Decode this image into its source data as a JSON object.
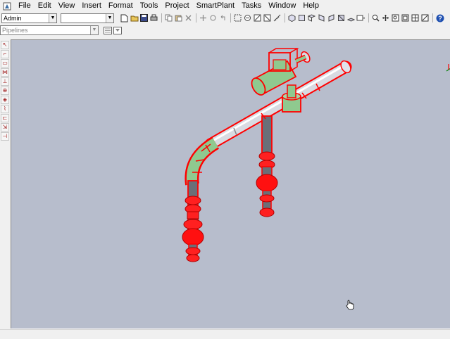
{
  "menubar": {
    "items": [
      "File",
      "Edit",
      "View",
      "Insert",
      "Format",
      "Tools",
      "Project",
      "SmartPlant",
      "Tasks",
      "Window",
      "Help"
    ]
  },
  "toolbar": {
    "workspace_value": "Admin",
    "filter_value": "",
    "help_label": "?"
  },
  "locate_filter": {
    "value": "Pipelines"
  },
  "colors": {
    "viewport_bg": "#b7bdcc",
    "selection_highlight": "#ff0000",
    "pipe_body": "#d8dbe2",
    "insulation_green": "#8fc98f",
    "fitting_gray": "#6a6f78"
  },
  "icons": {
    "app": "smartplant-app-icon",
    "axis": "axis-triad-icon",
    "cursor": "hand-cursor-icon"
  }
}
